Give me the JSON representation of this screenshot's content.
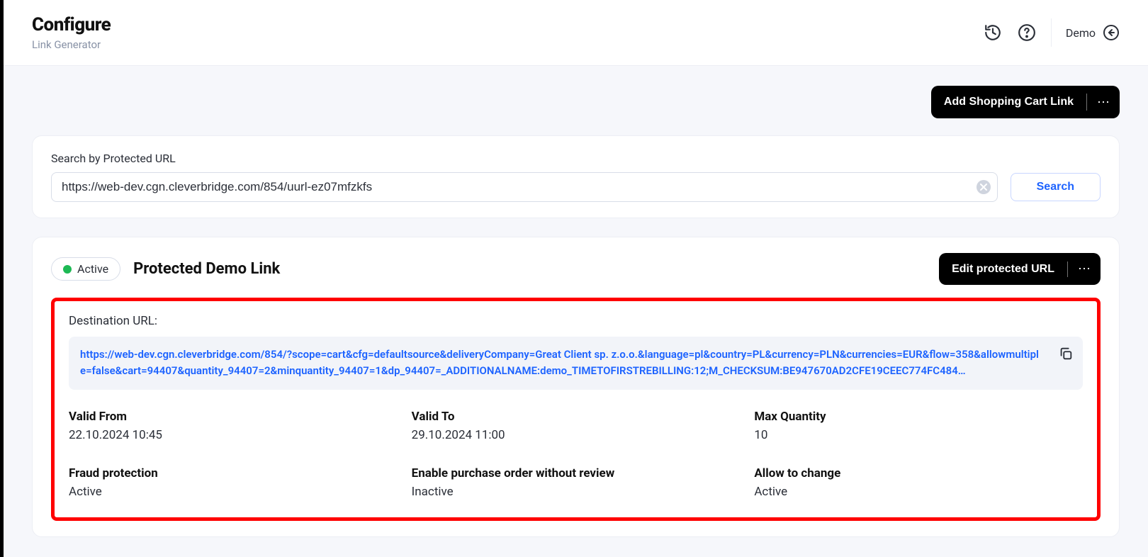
{
  "header": {
    "title": "Configure",
    "subtitle": "Link Generator",
    "user_label": "Demo"
  },
  "actions": {
    "add_cart_link_label": "Add Shopping Cart Link"
  },
  "search": {
    "label": "Search by Protected URL",
    "value": "https://web-dev.cgn.cleverbridge.com/854/uurl-ez07mfzkfs",
    "button_label": "Search"
  },
  "link": {
    "status_label": "Active",
    "title": "Protected Demo Link",
    "edit_button_label": "Edit protected URL",
    "destination_label": "Destination URL:",
    "destination_url": "https://web-dev.cgn.cleverbridge.com/854/?scope=cart&cfg=defaultsource&deliveryCompany=Great Client sp. z.o.o.&language=pl&country=PL&currency=PLN&currencies=EUR&flow=358&allowmultiple=false&cart=94407&quantity_94407=2&minquantity_94407=1&dp_94407=_ADDITIONALNAME:demo_TIMETOFIRSTREBILLING:12;M_CHECKSUM:BE947670AD2CFE19CEEC774FC484…",
    "fields": {
      "valid_from": {
        "label": "Valid From",
        "value": "22.10.2024 10:45"
      },
      "valid_to": {
        "label": "Valid To",
        "value": "29.10.2024 11:00"
      },
      "max_qty": {
        "label": "Max Quantity",
        "value": "10"
      },
      "fraud": {
        "label": "Fraud protection",
        "value": "Active"
      },
      "po_noreview": {
        "label": "Enable purchase order without review",
        "value": "Inactive"
      },
      "allow_change": {
        "label": "Allow to change",
        "value": "Active"
      }
    }
  }
}
